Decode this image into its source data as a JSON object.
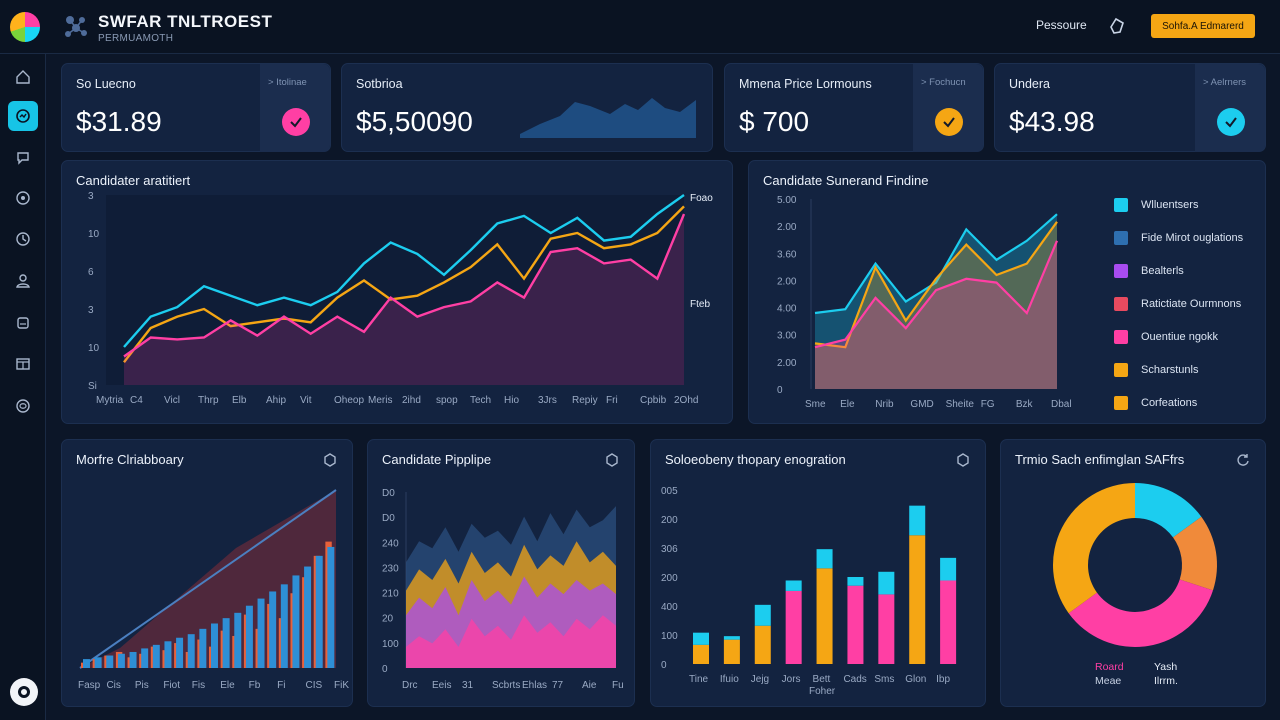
{
  "header": {
    "brand_title": "SWFAR TNLTROEST",
    "brand_subtitle": "PERMUAMOTH",
    "link": "Pessoure",
    "button": "Sohfa.A Edmarerd"
  },
  "sidebar": {
    "items": [
      {
        "icon": "home-icon",
        "active": false
      },
      {
        "icon": "dashboard-icon",
        "active": true
      },
      {
        "icon": "chat-icon",
        "active": false
      },
      {
        "icon": "target-icon",
        "active": false
      },
      {
        "icon": "clock-icon",
        "active": false
      },
      {
        "icon": "user-icon",
        "active": false
      },
      {
        "icon": "document-icon",
        "active": false
      },
      {
        "icon": "table-icon",
        "active": false
      },
      {
        "icon": "globe-icon",
        "active": false
      }
    ],
    "help_icon": "help-icon"
  },
  "kpis": [
    {
      "title": "So Luecno",
      "value": "$31.89",
      "side_label": "> Itolinae",
      "accent": "#ff3fa4"
    },
    {
      "title": "Sotbrioa",
      "value": "$5,50090",
      "side_label": "",
      "accent": "#1e4c80"
    },
    {
      "title": "Mmena Price Lormouns",
      "value": "$ 700",
      "side_label": "> Fochucn",
      "accent": "#f5a614"
    },
    {
      "title": "Undera",
      "value": "$43.98",
      "side_label": "> Aelrners",
      "accent": "#1ccdef"
    }
  ],
  "colors": {
    "cyan": "#1ccdef",
    "orange": "#f5a614",
    "pink": "#ff3fa4",
    "purple": "#a84cf0",
    "red": "#e84a5f",
    "blue": "#2e8fd6"
  },
  "panels": {
    "left_line": {
      "title": "Candidater aratitiert",
      "end_label_top": "Foao",
      "end_label_mid": "Fteb"
    },
    "right_area": {
      "title": "Candidate Sunerand Findine"
    },
    "funnel": {
      "title": "Morfre Clriabboary"
    },
    "pipeline": {
      "title": "Candidate Pipplipe"
    },
    "stacked": {
      "title": "Soloeobeny thopary enogration",
      "xlabel": "Foher"
    },
    "donut": {
      "title": "Trmio Sach enfimglan SAFfrs",
      "label_a1": "Roard",
      "label_a2": "Meae",
      "label_b1": "Yash",
      "label_b2": "Ilrrm."
    }
  },
  "legend": {
    "items": [
      {
        "label": "Wlluentsers",
        "color": "#1ccdef"
      },
      {
        "label": "Fide Mirot ouglations",
        "color": "#2e6fb0"
      },
      {
        "label": "Bealterls",
        "color": "#a84cf0"
      },
      {
        "label": "Ratictiate Ourmnons",
        "color": "#e84a5f"
      },
      {
        "label": "Ouentiue ngokk",
        "color": "#ff3fa4"
      },
      {
        "label": "Scharstunls",
        "color": "#f5a614"
      },
      {
        "label": "Corfeations",
        "color": "#f5a614"
      }
    ]
  },
  "chart_data": [
    {
      "type": "line",
      "title": "Candidater aratitiert",
      "x": [
        "Mytria",
        "C4",
        "Vicl",
        "Thrp",
        "Elb",
        "Ahip",
        "Vit",
        "Oheop",
        "Meris",
        "2ihd",
        "spop",
        "Tech",
        "Hio",
        "3Jrs",
        "Repiy",
        "Fri",
        "Cpbib",
        "2Ohd"
      ],
      "y_ticks": [
        "3",
        "10",
        "6",
        "3",
        "10",
        "Si"
      ],
      "ylim": [
        0,
        10
      ],
      "series": [
        {
          "name": "Foao",
          "color": "#1ccdef",
          "values": [
            2,
            3.6,
            4.1,
            5.2,
            4.7,
            4.2,
            4.6,
            4.2,
            4.9,
            6.4,
            7.5,
            6.9,
            5.8,
            7.1,
            8.5,
            8.9,
            8.0,
            8.8,
            7.6,
            7.8,
            9.0,
            10.0
          ]
        },
        {
          "name": "Fteb",
          "color": "#f5a614",
          "values": [
            1.2,
            3.0,
            3.6,
            4.0,
            3.1,
            3.3,
            3.5,
            3.3,
            4.6,
            5.5,
            4.5,
            4.7,
            5.4,
            6.2,
            7.4,
            5.6,
            7.7,
            8.0,
            7.2,
            7.4,
            8.0,
            9.4
          ]
        },
        {
          "color": "#ff3fa4",
          "values": [
            1.5,
            2.5,
            2.4,
            2.5,
            3.4,
            2.6,
            3.6,
            2.7,
            3.6,
            2.8,
            4.6,
            3.6,
            4.1,
            4.4,
            5.4,
            4.6,
            7.0,
            7.2,
            6.4,
            6.6,
            5.6,
            9.0
          ]
        }
      ]
    },
    {
      "type": "area",
      "title": "Candidate Sunerand Findine",
      "x": [
        "Sme",
        "Ele",
        "Nrib",
        "GMD",
        "Sheite",
        "FG",
        "Bzk",
        "Dbal"
      ],
      "y_ticks": [
        "5.00",
        "2.00",
        "3.60",
        "2.00",
        "4.00",
        "3.00",
        "2.00",
        "0"
      ],
      "ylim": [
        0,
        5
      ],
      "series": [
        {
          "color": "#1ccdef",
          "values": [
            2.0,
            2.1,
            3.3,
            2.3,
            2.8,
            4.2,
            3.4,
            3.9,
            4.6
          ]
        },
        {
          "color": "#f5a614",
          "values": [
            1.2,
            1.1,
            3.2,
            1.8,
            2.9,
            3.8,
            3.0,
            3.3,
            4.4
          ]
        },
        {
          "color": "#ff3fa4",
          "values": [
            1.1,
            1.3,
            2.4,
            1.6,
            2.6,
            2.9,
            2.8,
            2.0,
            3.9
          ]
        }
      ]
    },
    {
      "type": "bar",
      "title": "Morfre Clriabboary",
      "x": [
        "Fasp",
        "Cis",
        "Pis",
        "Fiot",
        "Fis",
        "Ele",
        "Fb",
        "Fi",
        "CIS",
        "FiK"
      ],
      "series": [
        {
          "color": "#2e8fd6",
          "values": [
            0.05,
            0.06,
            0.07,
            0.08,
            0.09,
            0.11,
            0.13,
            0.15,
            0.17,
            0.19,
            0.22,
            0.25,
            0.28,
            0.31,
            0.35,
            0.39,
            0.43,
            0.47,
            0.52,
            0.57,
            0.63,
            0.68
          ]
        },
        {
          "color": "#e8613a",
          "values": [
            0.03,
            0.05,
            0.07,
            0.09,
            0.06,
            0.08,
            0.12,
            0.1,
            0.14,
            0.09,
            0.16,
            0.12,
            0.21,
            0.18,
            0.3,
            0.22,
            0.36,
            0.28,
            0.42,
            0.51,
            0.63,
            0.71
          ]
        }
      ]
    },
    {
      "type": "area",
      "title": "Candidate Pipplipe",
      "x": [
        "Drc",
        "Eeis",
        "31",
        "Scbrts",
        "Ehlas",
        "77",
        "Aie",
        "Fu"
      ],
      "y_ticks": [
        "D0",
        "D0",
        "240",
        "230",
        "210",
        "20",
        "100",
        "0"
      ],
      "series": [
        {
          "color": "#2b4f7e",
          "values": [
            0.6,
            0.72,
            0.68,
            0.8,
            0.66,
            0.82,
            0.74,
            0.78,
            0.7,
            0.86,
            0.72,
            0.88,
            0.76,
            0.9,
            0.8,
            0.84,
            0.92
          ]
        },
        {
          "color": "#f5a614",
          "values": [
            0.44,
            0.56,
            0.5,
            0.62,
            0.48,
            0.66,
            0.54,
            0.6,
            0.52,
            0.7,
            0.56,
            0.64,
            0.58,
            0.72,
            0.6,
            0.66,
            0.58
          ]
        },
        {
          "color": "#a84cf0",
          "values": [
            0.3,
            0.4,
            0.34,
            0.46,
            0.3,
            0.5,
            0.38,
            0.44,
            0.36,
            0.52,
            0.4,
            0.48,
            0.42,
            0.5,
            0.44,
            0.48,
            0.42
          ]
        },
        {
          "color": "#ff3fa4",
          "values": [
            0.12,
            0.18,
            0.14,
            0.22,
            0.12,
            0.28,
            0.18,
            0.24,
            0.16,
            0.3,
            0.2,
            0.26,
            0.18,
            0.28,
            0.22,
            0.3,
            0.24
          ]
        }
      ]
    },
    {
      "type": "bar",
      "title": "Soloeobeny thopary enogration",
      "x": [
        "Tine",
        "Ifuio",
        "Jejg",
        "Jors",
        "Bett",
        "Cads",
        "Sms",
        "Glon",
        "Ibp"
      ],
      "y_ticks": [
        "005",
        "200",
        "306",
        "200",
        "400",
        "100",
        "0"
      ],
      "xlabel": "Foher",
      "series": [
        {
          "color": "#f5a614",
          "values": [
            0.11,
            0.14,
            0.22,
            0,
            0.55,
            0,
            0,
            0.74,
            0
          ]
        },
        {
          "color": "#ff3fa4",
          "values": [
            0,
            0,
            0,
            0.42,
            0,
            0.45,
            0.4,
            0,
            0.48
          ]
        },
        {
          "color": "#1ccdef",
          "values": [
            0.07,
            0.02,
            0.12,
            0.06,
            0.11,
            0.05,
            0.13,
            0.17,
            0.13
          ]
        }
      ]
    },
    {
      "type": "pie",
      "title": "Trmio Sach enfimglan SAFfrs",
      "labels": [
        "Roard",
        "Meae",
        "Yash",
        "Ilrrm."
      ],
      "series": [
        {
          "color": "#1ccdef",
          "value": 15
        },
        {
          "color": "#f08a3a",
          "value": 15
        },
        {
          "color": "#ff3fa4",
          "value": 35
        },
        {
          "color": "#f5a614",
          "value": 35
        }
      ]
    }
  ]
}
